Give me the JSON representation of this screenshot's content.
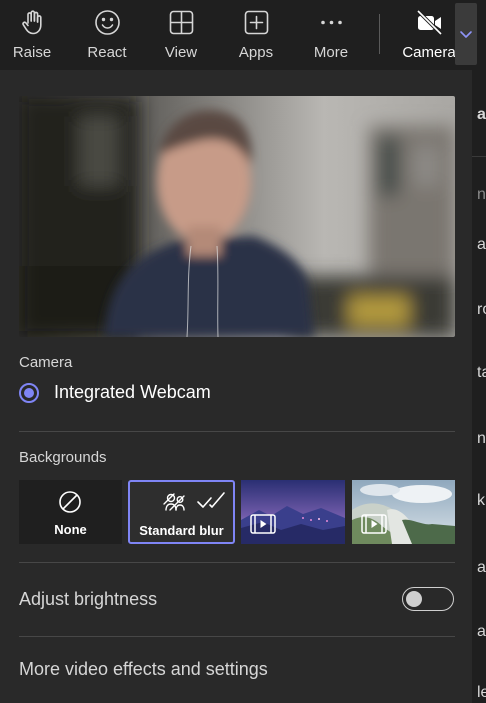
{
  "toolbar": {
    "raise": {
      "label": "Raise",
      "icon": "hand-icon"
    },
    "react": {
      "label": "React",
      "icon": "smiley-icon"
    },
    "view": {
      "label": "View",
      "icon": "grid-icon"
    },
    "apps": {
      "label": "Apps",
      "icon": "plus-square-icon"
    },
    "more": {
      "label": "More",
      "icon": "ellipsis-icon"
    },
    "camera": {
      "label": "Camera",
      "icon": "camera-off-icon"
    },
    "camera_options_icon": "chevron-down-icon"
  },
  "camera_section": {
    "heading": "Camera",
    "selected_device": "Integrated Webcam"
  },
  "backgrounds": {
    "heading": "Backgrounds",
    "options": [
      {
        "label": "None",
        "icon": "prohibited-icon"
      },
      {
        "label": "Standard blur",
        "icon": "blur-icon",
        "selected": true
      },
      {
        "label": "",
        "icon": "video-background-icon"
      },
      {
        "label": "",
        "icon": "video-background-icon"
      }
    ]
  },
  "brightness": {
    "label": "Adjust brightness",
    "enabled": false
  },
  "more_settings": {
    "label": "More video effects and settings"
  },
  "right_panel_fragments": [
    "a",
    "n",
    "ar",
    "ro",
    "ta",
    "ng",
    "k",
    "ac",
    "ag",
    "le"
  ],
  "colors": {
    "accent": "#7f85f5",
    "panel_bg": "#292929",
    "toolbar_bg": "#1f1f1f",
    "text": "#d6d6d6"
  }
}
